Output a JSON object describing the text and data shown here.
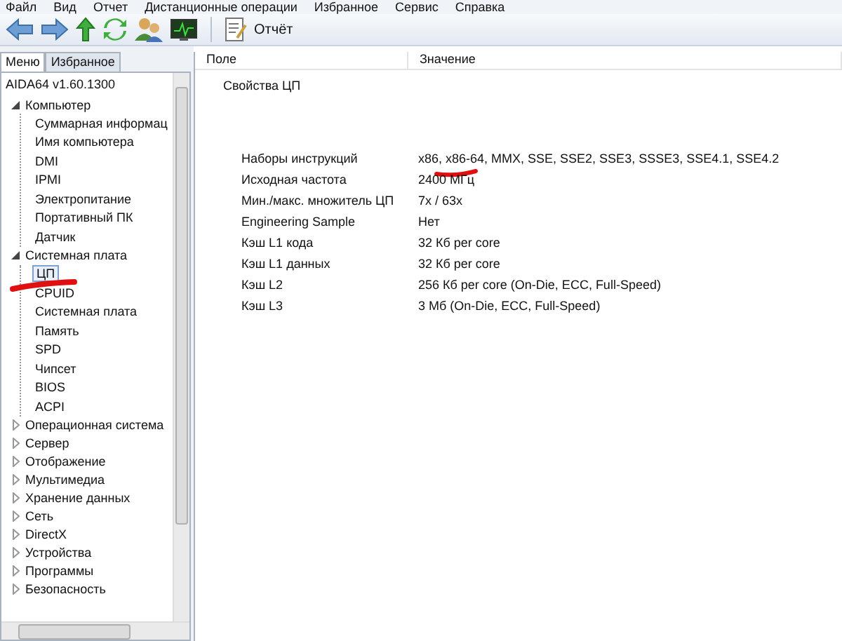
{
  "menu": [
    "Файл",
    "Вид",
    "Отчет",
    "Дистанционные операции",
    "Избранное",
    "Сервис",
    "Справка"
  ],
  "toolbar": {
    "buttons": [
      {
        "kind": "back"
      },
      {
        "kind": "forward"
      },
      {
        "kind": "up"
      },
      {
        "kind": "refresh"
      },
      {
        "kind": "users"
      },
      {
        "kind": "monitor"
      }
    ],
    "report": "Отчёт"
  },
  "left_tabs": [
    {
      "label": "Меню",
      "selected": true
    },
    {
      "label": "Избранное",
      "selected": false
    }
  ],
  "tree": {
    "root": "AIDA64 v1.60.1300",
    "items": [
      {
        "label": "Компьютер",
        "expanded": true,
        "children": [
          {
            "label": "Суммарная информац",
            "selected": false
          },
          {
            "label": "Имя компьютера",
            "selected": false
          },
          {
            "label": "DMI",
            "selected": false
          },
          {
            "label": "IPMI",
            "selected": false
          },
          {
            "label": "Электропитание",
            "selected": false
          },
          {
            "label": "Портативный ПК",
            "selected": false
          },
          {
            "label": "Датчик",
            "selected": false
          }
        ]
      },
      {
        "label": "Системная плата",
        "expanded": true,
        "children": [
          {
            "label": "ЦП",
            "selected": true
          },
          {
            "label": "CPUID",
            "selected": false
          },
          {
            "label": "Системная плата",
            "selected": false
          },
          {
            "label": "Память",
            "selected": false
          },
          {
            "label": "SPD",
            "selected": false
          },
          {
            "label": "Чипсет",
            "selected": false
          },
          {
            "label": "BIOS",
            "selected": false
          },
          {
            "label": "ACPI",
            "selected": false
          }
        ]
      },
      {
        "label": "Операционная система",
        "expanded": false
      },
      {
        "label": "Сервер",
        "expanded": false
      },
      {
        "label": "Отображение",
        "expanded": false
      },
      {
        "label": "Мультимедиа",
        "expanded": false
      },
      {
        "label": "Хранение данных",
        "expanded": false
      },
      {
        "label": "Сеть",
        "expanded": false
      },
      {
        "label": "DirectX",
        "expanded": false
      },
      {
        "label": "Устройства",
        "expanded": false
      },
      {
        "label": "Программы",
        "expanded": false
      },
      {
        "label": "Безопасность",
        "expanded": false
      }
    ]
  },
  "table": {
    "columns": [
      "Поле",
      "Значение"
    ],
    "section": "Свойства ЦП",
    "rows": [
      {
        "field": "Наборы инструкций",
        "value": "x86, x86-64, MMX, SSE, SSE2, SSE3, SSSE3, SSE4.1, SSE4.2"
      },
      {
        "field": "Исходная частота",
        "value": "2400 МГц"
      },
      {
        "field": "Мин./макс. множитель ЦП",
        "value": "7x / 63x"
      },
      {
        "field": "Engineering Sample",
        "value": "Нет"
      },
      {
        "field": "Кэш L1 кода",
        "value": "32 Кб per core"
      },
      {
        "field": "Кэш L1 данных",
        "value": "32 Кб per core"
      },
      {
        "field": "Кэш L2",
        "value": "256 Кб per core  (On-Die, ECC, Full-Speed)"
      },
      {
        "field": "Кэш L3",
        "value": "3 Мб  (On-Die, ECC, Full-Speed)"
      }
    ]
  }
}
